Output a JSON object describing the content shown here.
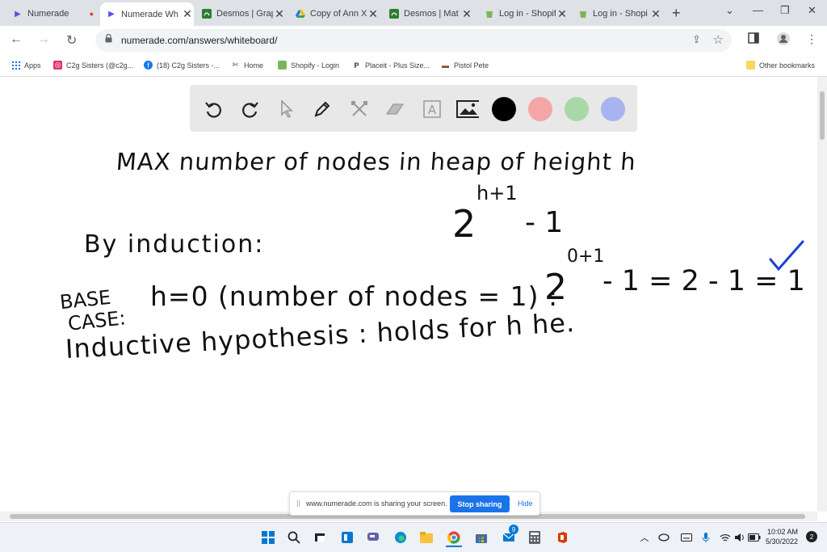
{
  "tabs": [
    {
      "title": "Numerade",
      "fav": "numerade-icon"
    },
    {
      "title": "Numerade Wh",
      "fav": "numerade-icon"
    },
    {
      "title": "Desmos | Grap",
      "fav": "desmos-icon"
    },
    {
      "title": "Copy of Ann X",
      "fav": "drive-icon"
    },
    {
      "title": "Desmos | Mat",
      "fav": "desmos-icon"
    },
    {
      "title": "Log in - Shopif",
      "fav": "shopify-icon"
    },
    {
      "title": "Log in - Shopi",
      "fav": "shopify-icon"
    }
  ],
  "address": {
    "url": "numerade.com/answers/whiteboard/"
  },
  "bookmarks": [
    {
      "label": "Apps"
    },
    {
      "label": "C2g Sisters (@c2g..."
    },
    {
      "label": "(18) C2g Sisters -..."
    },
    {
      "label": "Home"
    },
    {
      "label": "Shopify - Login"
    },
    {
      "label": "Placeit - Plus Size..."
    },
    {
      "label": "Pistol Pete"
    }
  ],
  "other_bookmarks": "Other bookmarks",
  "whiteboard": {
    "swatches": [
      "#000000",
      "#f4a6a6",
      "#a8d8a8",
      "#a8b4f0"
    ],
    "lines": {
      "l1": "MAX number of nodes in heap of height h",
      "l2_base": "2",
      "l2_exp": "h+1",
      "l2_rest": "- 1",
      "l3": "By induction:",
      "l4_label1": "BASE",
      "l4_label2": "CASE:",
      "l4_a": "h=0 (number of nodes = 1) :",
      "l4_b": "2",
      "l4_exp": "0+1",
      "l4_c": "- 1 = 2 - 1 = 1",
      "l5": "Inductive hypothesis : holds for h he."
    },
    "check_color": "#1a3fd6"
  },
  "sharing": {
    "message": "www.numerade.com is sharing your screen.",
    "stop": "Stop sharing",
    "hide": "Hide"
  },
  "taskbar": {
    "badge": "9",
    "time": "10:02 AM",
    "date": "5/30/2022",
    "notif": "2"
  }
}
